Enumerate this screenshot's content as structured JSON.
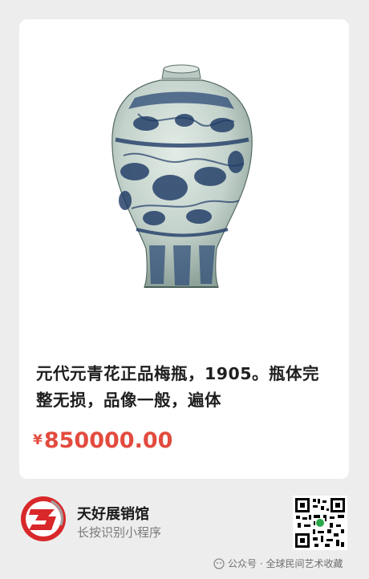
{
  "product": {
    "title": "元代元青花正品梅瓶，1905。瓶体完整无损，品像一般，遍体",
    "currency": "¥",
    "price": "850000.00"
  },
  "shop": {
    "name": "天好展销馆",
    "subtitle": "长按识别小程序"
  },
  "watermark": {
    "text": "公众号 · 全球民间艺术收藏"
  },
  "colors": {
    "price": "#e24b3e",
    "logo_red": "#d8282a",
    "porcelain_blue": "#1f3b66",
    "porcelain_base": "#c9d6cf"
  }
}
